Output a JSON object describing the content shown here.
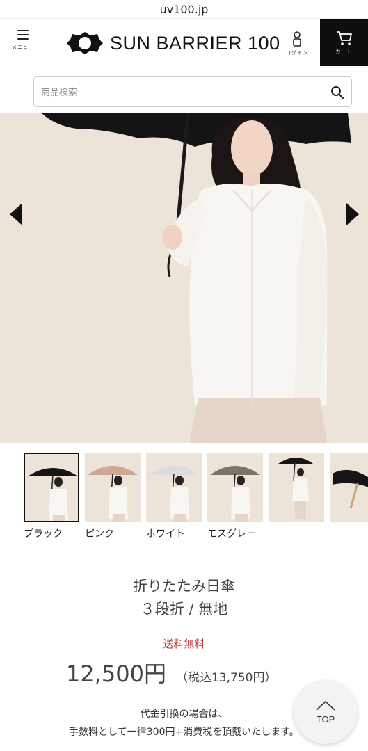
{
  "browser": {
    "url": "uv100.jp"
  },
  "header": {
    "menu_label": "メニュー",
    "logo_text": "SUN BARRIER 100",
    "login_label": "ログイン",
    "cart_label": "カート"
  },
  "search": {
    "placeholder": "商品検索"
  },
  "thumbnails": [
    {
      "label": "ブラック",
      "canopy": "#151515",
      "selected": true
    },
    {
      "label": "ピンク",
      "canopy": "#cfa792",
      "selected": false
    },
    {
      "label": "ホワイト",
      "canopy": "#dcdcdc",
      "selected": false
    },
    {
      "label": "モスグレー",
      "canopy": "#7a7466",
      "selected": false
    },
    {
      "label": "",
      "canopy": "#151515",
      "selected": false
    },
    {
      "label": "",
      "canopy": "#151515",
      "selected": false
    }
  ],
  "product": {
    "title_line1": "折りたたみ日傘",
    "title_line2": "３段折 / 無地",
    "shipping": "送料無料",
    "price": "12,500円",
    "price_tax": "（税込13,750円）",
    "cod_line1": "代金引換の場合は、",
    "cod_line2": "手数料として一律300円+消費税を頂戴いたします。"
  },
  "top_button": {
    "label": "TOP"
  },
  "colors": {
    "accent_red": "#b23a3a",
    "cart_bg": "#0e0e0e",
    "photo_bg": "#ece4d8"
  }
}
